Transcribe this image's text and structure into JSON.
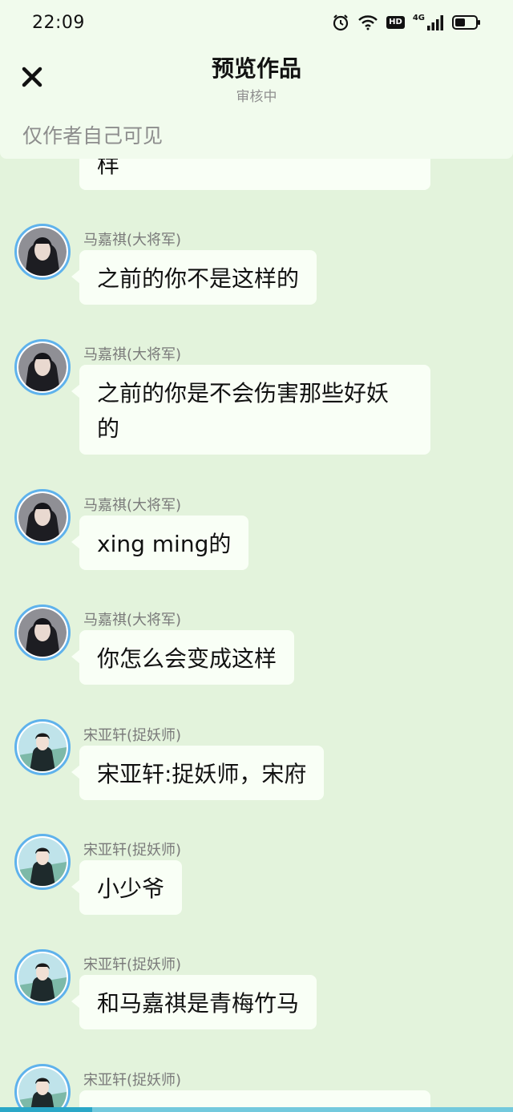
{
  "status_bar": {
    "time": "22:09",
    "icons": [
      "alarm-icon",
      "wifi-icon",
      "hd-badge",
      "signal-4g-icon",
      "battery-icon"
    ],
    "hd_label": "HD",
    "network_label": "4G"
  },
  "header": {
    "title": "预览作品",
    "subtitle": "审核中",
    "visibility_note": "仅作者自己可见",
    "close_icon": "close-icon"
  },
  "messages": [
    {
      "partial_text": "样"
    },
    {
      "sender": "马嘉祺(大将军)",
      "text": "之前的你不是这样的"
    },
    {
      "sender": "马嘉祺(大将军)",
      "text_line1": "之前的你是不会伤害那些好妖",
      "text_line2": "的"
    },
    {
      "sender": "马嘉祺(大将军)",
      "text": "xing ming的"
    },
    {
      "sender": "马嘉祺(大将军)",
      "text": "你怎么会变成这样"
    },
    {
      "sender": "宋亚轩(捉妖师)",
      "text": "宋亚轩:捉妖师，宋府"
    },
    {
      "sender": "宋亚轩(捉妖师)",
      "text": "小少爷"
    },
    {
      "sender": "宋亚轩(捉妖师)",
      "text": "和马嘉祺是青梅竹马"
    },
    {
      "sender": "宋亚轩(捉妖师)",
      "text": ""
    }
  ],
  "colors": {
    "background": "#e3f3dc",
    "header_bg": "#f1fbed",
    "bubble_bg": "#f9fff6",
    "avatar_ring": "#5fb2ec",
    "accent_strip": "#2aa7c7"
  }
}
